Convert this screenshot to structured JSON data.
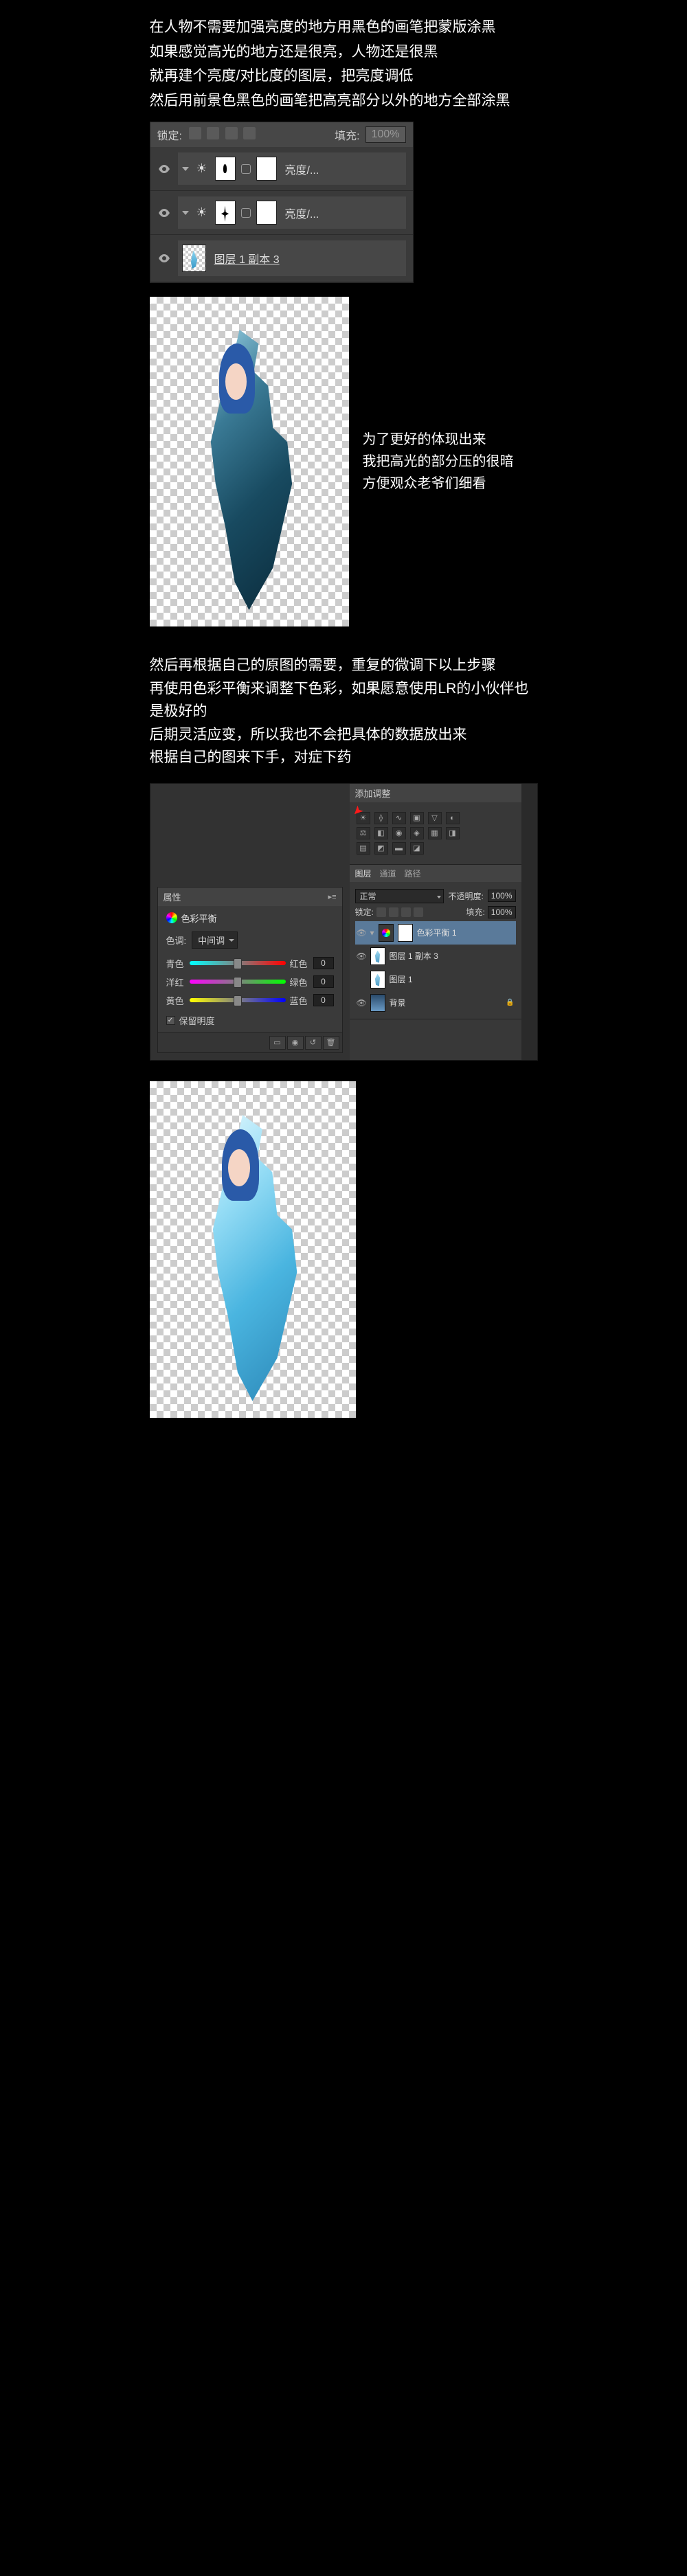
{
  "intro": {
    "line1": "在人物不需要加强亮度的地方用黑色的画笔把蒙版涂黑",
    "line2": "如果感觉高光的地方还是很亮，人物还是很黑",
    "line3": "就再建个亮度/对比度的图层，把亮度调低",
    "line4": "然后用前景色黑色的画笔把高亮部分以外的地方全部涂黑"
  },
  "layers_panel": {
    "lock_label": "锁定:",
    "fill_label": "填充:",
    "fill_value": "100%",
    "rows": [
      {
        "name": "亮度/..."
      },
      {
        "name": "亮度/..."
      },
      {
        "name": "图层 1 副本 3"
      }
    ]
  },
  "side_note": {
    "l1": "为了更好的体现出来",
    "l2": "我把高光的部分压的很暗",
    "l3": "方便观众老爷们细看"
  },
  "mid": {
    "l1": "然后再根据自己的原图的需要，重复的微调下以上步骤",
    "l2": "再使用色彩平衡来调整下色彩，如果愿意使用LR的小伙伴也是极好的",
    "l3": "后期灵活应变，所以我也不会把具体的数据放出来",
    "l4": "根据自己的图来下手，对症下药"
  },
  "props": {
    "tab": "属性",
    "title": "色彩平衡",
    "tone_label": "色调:",
    "tone_value": "中间调",
    "sliders": [
      {
        "l": "青色",
        "r": "红色",
        "v": "0"
      },
      {
        "l": "洋红",
        "r": "绿色",
        "v": "0"
      },
      {
        "l": "黄色",
        "r": "蓝色",
        "v": "0"
      }
    ],
    "preserve": "保留明度",
    "check": "✓"
  },
  "adj_panel": {
    "title": "添加调整"
  },
  "layers2": {
    "tabs": [
      "图层",
      "通道",
      "路径"
    ],
    "mode": "正常",
    "opac_l": "不透明度:",
    "opac_v": "100%",
    "lock": "锁定:",
    "fill_l": "填充:",
    "fill_v": "100%",
    "rows": [
      {
        "name": "色彩平衡 1"
      },
      {
        "name": "图层 1 副本 3"
      },
      {
        "name": "图层 1"
      },
      {
        "name": "背景"
      }
    ]
  }
}
